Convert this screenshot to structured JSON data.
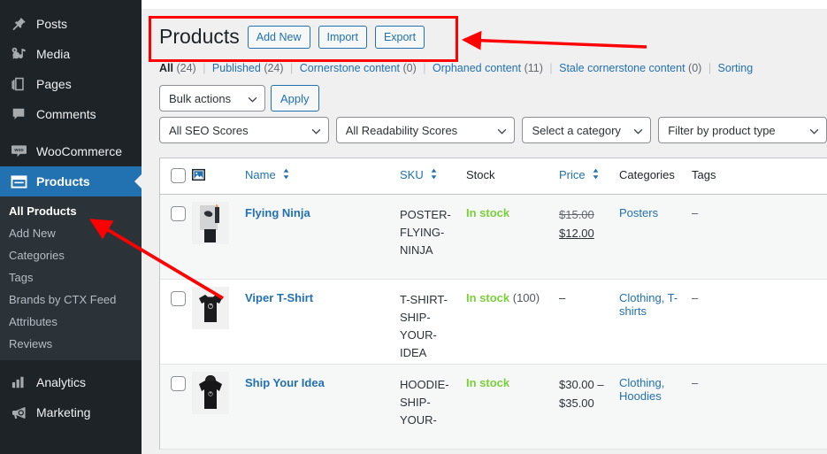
{
  "sidebar": {
    "items": [
      {
        "label": "Posts",
        "icon": "pin-icon",
        "current": false
      },
      {
        "label": "Media",
        "icon": "media-icon",
        "current": false
      },
      {
        "label": "Pages",
        "icon": "pages-icon",
        "current": false
      },
      {
        "label": "Comments",
        "icon": "comment-icon",
        "current": false
      },
      {
        "label": "WooCommerce",
        "icon": "woocommerce-icon",
        "current": false
      },
      {
        "label": "Products",
        "icon": "products-icon",
        "current": true
      },
      {
        "label": "Analytics",
        "icon": "analytics-icon",
        "current": false
      },
      {
        "label": "Marketing",
        "icon": "megaphone-icon",
        "current": false
      }
    ],
    "submenu": [
      {
        "label": "All Products",
        "active": true
      },
      {
        "label": "Add New",
        "active": false
      },
      {
        "label": "Categories",
        "active": false
      },
      {
        "label": "Tags",
        "active": false
      },
      {
        "label": "Brands by CTX Feed",
        "active": false
      },
      {
        "label": "Attributes",
        "active": false
      },
      {
        "label": "Reviews",
        "active": false
      }
    ],
    "active_color": "#2271b1"
  },
  "header": {
    "title": "Products",
    "buttons": [
      {
        "label": "Add New"
      },
      {
        "label": "Import"
      },
      {
        "label": "Export"
      }
    ]
  },
  "status_links": [
    {
      "label": "All",
      "count": "(24)",
      "current": true
    },
    {
      "label": "Published",
      "count": "(24)",
      "current": false
    },
    {
      "label": "Cornerstone content",
      "count": "(0)",
      "current": false
    },
    {
      "label": "Orphaned content",
      "count": "(11)",
      "current": false
    },
    {
      "label": "Stale cornerstone content",
      "count": "(0)",
      "current": false
    },
    {
      "label": "Sorting",
      "count": "",
      "current": false
    }
  ],
  "tablenav": {
    "bulk_actions": "Bulk actions",
    "apply_label": "Apply",
    "filters": [
      {
        "label": "All SEO Scores"
      },
      {
        "label": "All Readability Scores"
      },
      {
        "label": "Select a category"
      },
      {
        "label": "Filter by product type"
      }
    ]
  },
  "table": {
    "columns": [
      {
        "label": "",
        "sortable": false,
        "link": false
      },
      {
        "label": "",
        "sortable": false,
        "link": false
      },
      {
        "label": "Name",
        "sortable": true,
        "link": true
      },
      {
        "label": "SKU",
        "sortable": true,
        "link": true
      },
      {
        "label": "Stock",
        "sortable": false,
        "link": false
      },
      {
        "label": "Price",
        "sortable": true,
        "link": true
      },
      {
        "label": "Categories",
        "sortable": false,
        "link": false
      },
      {
        "label": "Tags",
        "sortable": false,
        "link": false
      }
    ],
    "rows": [
      {
        "name": "Flying Ninja",
        "sku": "POSTER-FLYING-NINJA",
        "stock": "In stock",
        "stock_qty": "",
        "price_old": "$15.00",
        "price_new": "$12.00",
        "price_plain": "",
        "categories": "Posters",
        "tags": "–",
        "thumb": "poster-flying-ninja-thumbnail"
      },
      {
        "name": "Viper T-Shirt",
        "sku": "T-SHIRT-SHIP-YOUR-IDEA",
        "stock": "In stock",
        "stock_qty": "(100)",
        "price_old": "",
        "price_new": "",
        "price_plain": "–",
        "categories": "Clothing, T-shirts",
        "tags": "–",
        "thumb": "viper-tshirt-thumbnail"
      },
      {
        "name": "Ship Your Idea",
        "sku": "HOODIE-SHIP-YOUR-",
        "stock": "In stock",
        "stock_qty": "",
        "price_old": "",
        "price_new": "",
        "price_plain": "$30.00 – $35.00",
        "categories": "Clothing, Hoodies",
        "tags": "–",
        "thumb": "ship-your-idea-hoodie-thumbnail"
      }
    ]
  },
  "annotations": {
    "color": "#ff0000",
    "box_target": "Products",
    "arrows": [
      {
        "name": "arrow-to-page-title"
      },
      {
        "name": "arrow-to-all-products"
      }
    ]
  }
}
